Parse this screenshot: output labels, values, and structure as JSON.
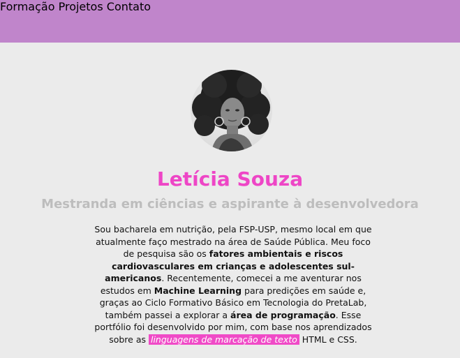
{
  "nav": {
    "items": [
      {
        "label": "Formação"
      },
      {
        "label": "Projetos"
      },
      {
        "label": "Contato"
      }
    ]
  },
  "profile": {
    "name": "Letícia Souza",
    "subtitle": "Mestranda em ciências e aspirante à desenvolvedora",
    "avatar_icon": "profile-photo"
  },
  "bio": {
    "t1": "Sou bacharela em nutrição, pela FSP-USP, mesmo local em que atualmente faço mestrado na área de Saúde Pública. Meu foco de pesquisa são os ",
    "b1": "fatores ambientais e riscos cardiovasculares em crianças e adolescentes sul-americanos",
    "t2": ". Recentemente, comecei a me aventurar nos estudos em ",
    "b2": "Machine Learning",
    "t3": " para predições em saúde e, graças ao Ciclo Formativo Básico em Tecnologia do PretaLab, também passei a explorar a ",
    "b3": "área de programação",
    "t4": ". Esse portfólio foi desenvolvido por mim, com base nos aprendizados sobre as ",
    "highlight": "linguagens de marcação de texto",
    "t5": " HTML e CSS."
  },
  "colors": {
    "header": "#c085cb",
    "accent": "#ee46c6",
    "background": "#ebebeb",
    "subtitle": "#bdbdbd"
  }
}
